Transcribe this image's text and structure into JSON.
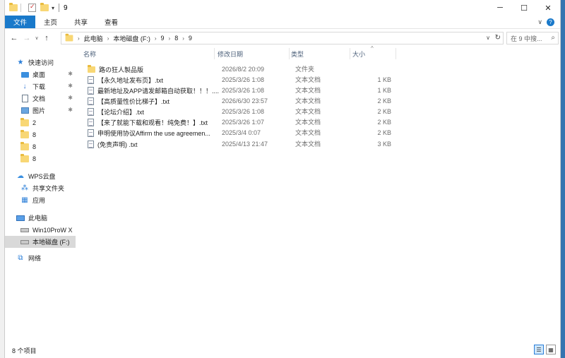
{
  "titlebar": {
    "title": "9",
    "controls": {
      "minimize": "─",
      "maximize": "☐",
      "close": "✕"
    }
  },
  "ribbon": {
    "tabs": [
      "文件",
      "主页",
      "共享",
      "查看"
    ],
    "expand_glyph": "∨",
    "help_glyph": "?"
  },
  "address": {
    "back": "←",
    "forward": "→",
    "up": "↑",
    "crumbs": [
      "此电脑",
      "本地磁盘 (F:)",
      "9",
      "8",
      "9"
    ],
    "sep": "›",
    "dropdown": "∨",
    "refresh": "↻",
    "search_placeholder": "在 9 中搜...",
    "search_glyph": "⌕"
  },
  "nav": {
    "items": [
      {
        "label": "快速访问",
        "icon": "star-icon",
        "pinned": false
      },
      {
        "label": "桌面",
        "icon": "desktop-icon",
        "pinned": true
      },
      {
        "label": "下载",
        "icon": "download-icon",
        "pinned": true
      },
      {
        "label": "文档",
        "icon": "document-icon",
        "pinned": true
      },
      {
        "label": "图片",
        "icon": "pictures-icon",
        "pinned": true
      },
      {
        "label": "2",
        "icon": "folder-icon",
        "pinned": false
      },
      {
        "label": "8",
        "icon": "folder-icon",
        "pinned": false
      },
      {
        "label": "8",
        "icon": "folder-icon",
        "pinned": false
      },
      {
        "label": "8",
        "icon": "folder-icon",
        "pinned": false
      },
      {
        "label": "WPS云盘",
        "icon": "cloud-icon",
        "pinned": false
      },
      {
        "label": "共享文件夹",
        "icon": "share-icon",
        "pinned": false
      },
      {
        "label": "应用",
        "icon": "apps-icon",
        "pinned": false
      },
      {
        "label": "此电脑",
        "icon": "computer-icon",
        "pinned": false
      },
      {
        "label": "Win10ProW X",
        "icon": "drive-icon",
        "pinned": false
      },
      {
        "label": "本地磁盘 (F:)",
        "icon": "drive-icon",
        "pinned": false,
        "selected": true
      },
      {
        "label": "网络",
        "icon": "network-icon",
        "pinned": false
      }
    ],
    "pin_glyph": "📌"
  },
  "list": {
    "columns": {
      "name": "名称",
      "date": "修改日期",
      "type": "类型",
      "size": "大小"
    },
    "sort_glyph": "^",
    "rows": [
      {
        "name": "路の狂人製品版",
        "date": "2026/8/2 20:09",
        "type": "文件夹",
        "size": "",
        "kind": "folder"
      },
      {
        "name": "【永久地址发布页】.txt",
        "date": "2025/3/26 1:08",
        "type": "文本文档",
        "size": "1 KB",
        "kind": "txt"
      },
      {
        "name": "最新地址及APP请发邮箱自动获取！！！....",
        "date": "2025/3/26 1:08",
        "type": "文本文档",
        "size": "1 KB",
        "kind": "txt"
      },
      {
        "name": "【高质量性价比梯子】.txt",
        "date": "2026/6/30 23:57",
        "type": "文本文档",
        "size": "2 KB",
        "kind": "txt"
      },
      {
        "name": "【论坛介绍】.txt",
        "date": "2025/3/26 1:08",
        "type": "文本文档",
        "size": "2 KB",
        "kind": "txt"
      },
      {
        "name": "【来了就能下载和观看！纯免费！】.txt",
        "date": "2025/3/26 1:07",
        "type": "文本文档",
        "size": "2 KB",
        "kind": "txt"
      },
      {
        "name": "申明使用协议Affirm the use agreemen...",
        "date": "2025/3/4 0:07",
        "type": "文本文档",
        "size": "2 KB",
        "kind": "txt"
      },
      {
        "name": "(免责声明) .txt",
        "date": "2025/4/13 21:47",
        "type": "文本文档",
        "size": "3 KB",
        "kind": "txt"
      }
    ]
  },
  "status": {
    "count": "8 个项目"
  }
}
